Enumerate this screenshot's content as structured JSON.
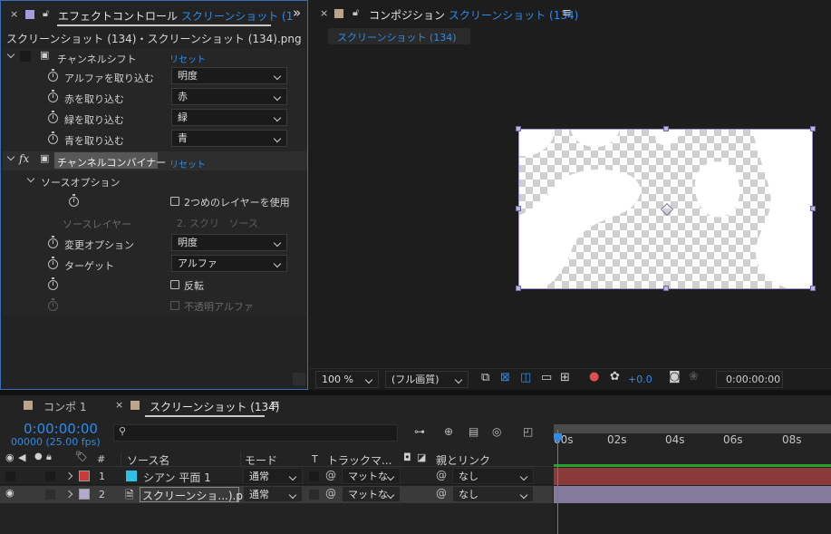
{
  "effect_panel": {
    "tab_close": "×",
    "tab_title": "エフェクトコントロール",
    "tab_layer": "スクリーンショット (1",
    "overflow": "»",
    "subtitle": "スクリーンショット (134)・スクリーンショット (134).png",
    "channel_shift": {
      "name": "チャンネルシフト",
      "reset": "リセット",
      "props": [
        {
          "label": "アルファを取り込む",
          "value": "明度"
        },
        {
          "label": "赤を取り込む",
          "value": "赤"
        },
        {
          "label": "緑を取り込む",
          "value": "緑"
        },
        {
          "label": "青を取り込む",
          "value": "青"
        }
      ]
    },
    "channel_combiner": {
      "fx": "fx",
      "name": "チャンネルコンバイナー",
      "reset": "リセット",
      "source_options": "ソースオプション",
      "use_second_layer": "2つめのレイヤーを使用",
      "source_layer_label": "ソースレイヤー",
      "source_layer_value": "2. スクリ",
      "source_layer_value2": "ソース",
      "change_option_label": "変更オプション",
      "change_option_value": "明度",
      "target_label": "ターゲット",
      "target_value": "アルファ",
      "invert_label": "反転",
      "opaque_alpha_label": "不透明アルファ"
    }
  },
  "comp_panel": {
    "tab_title": "コンポジション",
    "tab_comp": "スクリーンショット (134)",
    "menu": "≡",
    "subtab": "スクリーンショット (134)",
    "zoom": "100 %",
    "quality": "(フル画質)",
    "exposure": "+0.0",
    "timecode": "0:00:00:00"
  },
  "timeline": {
    "tab1": "コンポ 1",
    "tab2_close": "×",
    "tab2": "スクリーンショット (134)",
    "menu": "≡",
    "current_time": "0:00:00:00",
    "frame_info": "00000 (25.00 fps)",
    "search_placeholder": "",
    "col_hash": "#",
    "col_source": "ソース名",
    "col_mode": "モード",
    "col_t": "T",
    "col_track": "トラックマ...",
    "col_parent": "親とリンク",
    "ruler": [
      "00s",
      "02s",
      "04s",
      "06s",
      "08s"
    ],
    "layers": [
      {
        "num": "1",
        "name": "シアン 平面 1",
        "mode": "通常",
        "track": "マットな",
        "parent": "なし",
        "label_color": "#c93a3a",
        "icon_color": "#2fc0e6",
        "bar_color": "#8a3a3a"
      },
      {
        "num": "2",
        "name": "スクリーンショ...).png",
        "mode": "通常",
        "track": "マットな",
        "parent": "なし",
        "label_color": "#b3a9cf",
        "icon_color": "#dddddd",
        "bar_color": "#847a9c"
      }
    ]
  },
  "colors": {
    "accent_blue": "#2d8ceb",
    "panel_outline": "#3a6fb8"
  }
}
